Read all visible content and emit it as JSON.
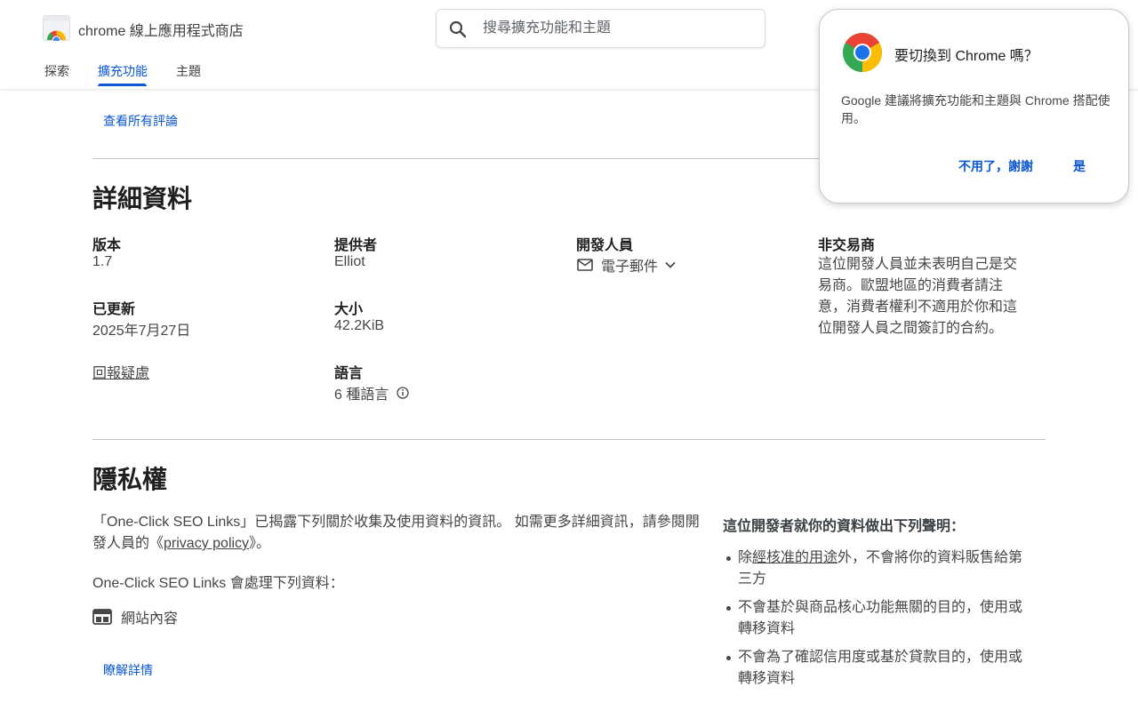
{
  "header": {
    "store_title": "chrome 線上應用程式商店",
    "search_placeholder": "搜尋擴充功能和主題",
    "tabs": [
      {
        "label": "探索",
        "active": false
      },
      {
        "label": "擴充功能",
        "active": true
      },
      {
        "label": "主題",
        "active": false
      }
    ],
    "accent_color": "#0b57d0"
  },
  "reviews": {
    "see_all_label": "查看所有評論"
  },
  "details": {
    "title": "詳細資料",
    "version_label": "版本",
    "version_value": "1.7",
    "updated_label": "已更新",
    "updated_value": "2025年7月27日",
    "report_label": "回報疑慮",
    "offered_by_label": "提供者",
    "offered_by_value": "Elliot",
    "size_label": "大小",
    "size_value": "42.2KiB",
    "languages_label": "語言",
    "languages_value": "6 種語言",
    "developer_label": "開發人員",
    "developer_email": "電子郵件",
    "trader_label": "非交易商",
    "trader_text": "這位開發人員並未表明自己是交易商。歐盟地區的消費者請注意，消費者權利不適用於你和這位開發人員之間簽訂的合約。"
  },
  "privacy": {
    "title": "隱私權",
    "intro_before": "「One-Click SEO Links」已揭露下列關於收集及使用資料的資訊。 如需更多詳細資訊，請參閱開發人員的《",
    "policy_link": "privacy policy",
    "intro_after": "》。",
    "handles_label": "One-Click SEO Links 會處理下列資料：",
    "data_types": [
      "網站內容"
    ],
    "learn_more": "瞭解詳情",
    "declarations_title": "這位開發者就你的資料做出下列聲明：",
    "declaration_1_before": "除",
    "declaration_1_link": "經核准的用途",
    "declaration_1_after": "外，不會將你的資料販售給第三方",
    "declaration_2": "不會基於與商品核心功能無關的目的，使用或轉移資料",
    "declaration_3": "不會為了確認信用度或基於貸款目的，使用或轉移資料"
  },
  "popup": {
    "title": "要切換到 Chrome 嗎？",
    "body": "Google 建議將擴充功能和主題與 Chrome 搭配使用。",
    "decline_label": "不用了，謝謝",
    "accept_label": "是"
  }
}
